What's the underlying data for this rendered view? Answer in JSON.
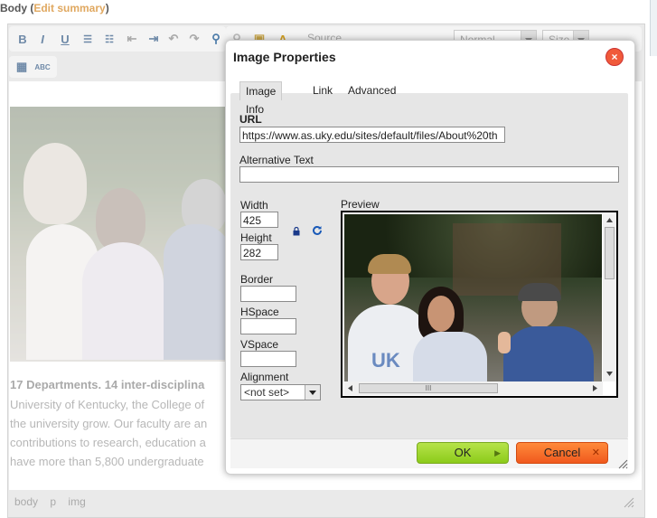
{
  "field": {
    "label": "Body",
    "edit_summary_open": " (",
    "edit_summary": "Edit summary",
    "edit_summary_close": ")"
  },
  "toolbar": {
    "buttons": [
      {
        "icon": "bold-icon",
        "glyph": "B"
      },
      {
        "icon": "italic-icon",
        "glyph": "I"
      },
      {
        "icon": "underline-icon",
        "glyph": "U"
      },
      {
        "icon": "bulleted-list-icon",
        "glyph": "☰"
      },
      {
        "icon": "numbered-list-icon",
        "glyph": "☷"
      },
      {
        "icon": "outdent-icon",
        "glyph": "⇤"
      },
      {
        "icon": "indent-icon",
        "glyph": "⇥"
      },
      {
        "icon": "undo-icon",
        "glyph": "↶"
      },
      {
        "icon": "redo-icon",
        "glyph": "↷"
      },
      {
        "icon": "link-icon",
        "glyph": "⚲"
      },
      {
        "icon": "unlink-icon",
        "glyph": "⚲"
      },
      {
        "icon": "image-icon",
        "glyph": "▣"
      },
      {
        "icon": "text-color-icon",
        "glyph": "A"
      }
    ],
    "source_label": "Source",
    "format_value": "Normal",
    "size_value": "Size",
    "row2": [
      {
        "icon": "table-icon",
        "glyph": "▦"
      },
      {
        "icon": "spellcheck-icon",
        "glyph": "ABC"
      }
    ]
  },
  "content": {
    "lines": [
      "17 Departments. 14 inter-disciplina",
      "University of Kentucky, the College of",
      "the university grow. Our faculty are an",
      "contributions to research, education a",
      "have more than 5,800 undergraduate"
    ]
  },
  "statusbar": {
    "path": [
      "body",
      "p",
      "img"
    ]
  },
  "dialog": {
    "title": "Image Properties",
    "close_glyph": "×",
    "tabs": [
      "Image Info",
      "Link",
      "Advanced"
    ],
    "active_tab": 0,
    "url_label": "URL",
    "url_value": "https://www.as.uky.edu/sites/default/files/About%20th",
    "alt_label": "Alternative Text",
    "alt_value": "",
    "width_label": "Width",
    "width_value": "425",
    "height_label": "Height",
    "height_value": "282",
    "border_label": "Border",
    "border_value": "",
    "hspace_label": "HSpace",
    "hspace_value": "",
    "vspace_label": "VSpace",
    "vspace_value": "",
    "alignment_label": "Alignment",
    "alignment_value": "<not set>",
    "preview_label": "Preview",
    "hscroll_grip": "III",
    "ok_label": "OK",
    "cancel_label": "Cancel",
    "ok_chevron": "▶",
    "cancel_x": "✕"
  },
  "colors": {
    "ok_button": "#9ed62e",
    "cancel_button": "#f36a26",
    "close_button": "#f05a3a",
    "edit_summary_link": "#e0a860"
  }
}
